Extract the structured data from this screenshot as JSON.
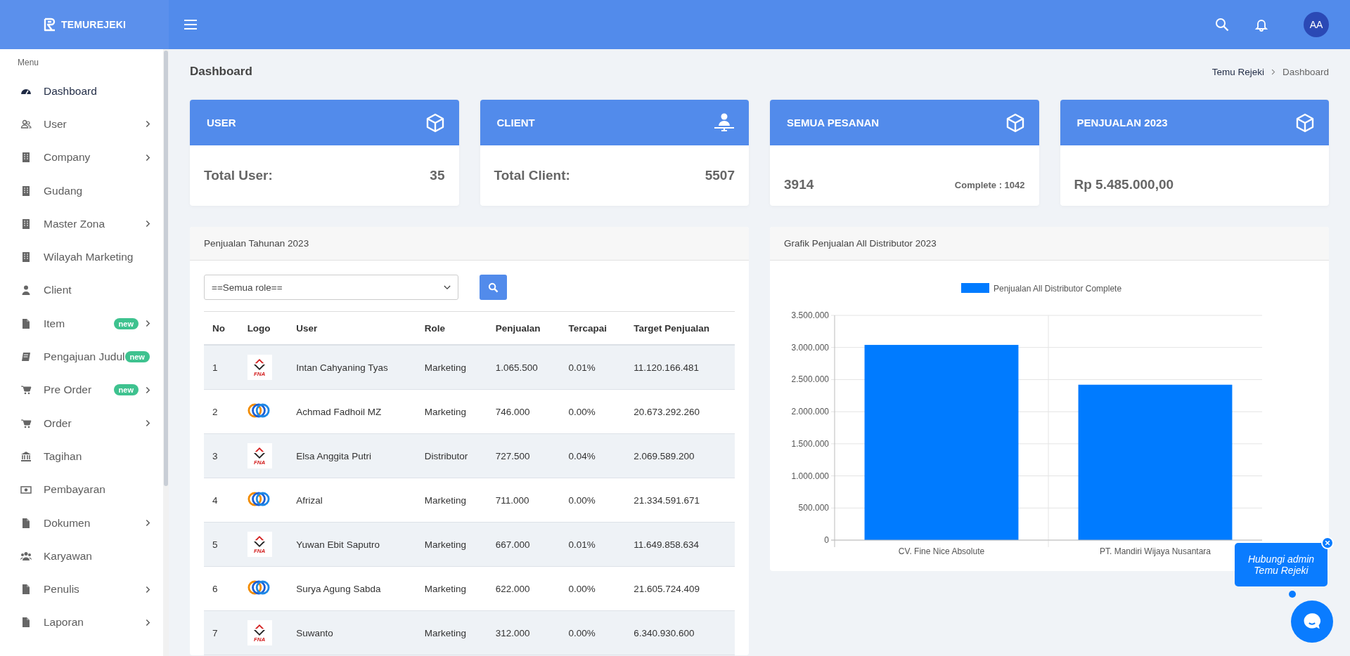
{
  "brand": {
    "name": "TEMUREJEKI"
  },
  "header": {
    "avatar": "AA"
  },
  "sidebar": {
    "heading": "Menu",
    "items": [
      {
        "label": "Dashboard",
        "kind": "gauge",
        "selected": true,
        "expandable": false
      },
      {
        "label": "User",
        "kind": "users",
        "selected": false,
        "expandable": true
      },
      {
        "label": "Company",
        "kind": "building",
        "selected": false,
        "expandable": true
      },
      {
        "label": "Gudang",
        "kind": "building",
        "selected": false,
        "expandable": false
      },
      {
        "label": "Master Zona",
        "kind": "building",
        "selected": false,
        "expandable": true
      },
      {
        "label": "Wilayah Marketing",
        "kind": "building",
        "selected": false,
        "expandable": false
      },
      {
        "label": "Client",
        "kind": "user",
        "selected": false,
        "expandable": false
      },
      {
        "label": "Item",
        "kind": "file",
        "selected": false,
        "expandable": true,
        "badge": "new"
      },
      {
        "label": "Pengajuan Judul",
        "kind": "book",
        "selected": false,
        "expandable": false,
        "badge": "new"
      },
      {
        "label": "Pre Order",
        "kind": "cart",
        "selected": false,
        "expandable": true,
        "badge": "new"
      },
      {
        "label": "Order",
        "kind": "cart",
        "selected": false,
        "expandable": true
      },
      {
        "label": "Tagihan",
        "kind": "bank",
        "selected": false,
        "expandable": false
      },
      {
        "label": "Pembayaran",
        "kind": "money",
        "selected": false,
        "expandable": false
      },
      {
        "label": "Dokumen",
        "kind": "file",
        "selected": false,
        "expandable": true
      },
      {
        "label": "Karyawan",
        "kind": "group",
        "selected": false,
        "expandable": false
      },
      {
        "label": "Penulis",
        "kind": "file",
        "selected": false,
        "expandable": true
      },
      {
        "label": "Laporan",
        "kind": "file",
        "selected": false,
        "expandable": true
      }
    ]
  },
  "page": {
    "title": "Dashboard",
    "breadcrumb": [
      "Temu Rejeki",
      "Dashboard"
    ]
  },
  "stats": [
    {
      "title": "USER",
      "kind": "cube",
      "label": "Total User:",
      "value": "35"
    },
    {
      "title": "CLIENT",
      "kind": "person",
      "label": "Total Client:",
      "value": "5507"
    },
    {
      "title": "SEMUA PESANAN",
      "kind": "cube",
      "value": "3914",
      "note": "Complete : 1042"
    },
    {
      "title": "PENJUALAN 2023",
      "kind": "cube",
      "value": "Rp 5.485.000,00"
    }
  ],
  "sales_table": {
    "title": "Penjualan Tahunan 2023",
    "role_select": "==Semua role==",
    "columns": [
      "No",
      "Logo",
      "User",
      "Role",
      "Penjualan",
      "Tercapai",
      "Target Penjualan"
    ],
    "rows": [
      {
        "no": "1",
        "kind": "fna",
        "logo_text": "FNA",
        "user": "Intan Cahyaning Tyas",
        "role": "Marketing",
        "sales": "1.065.500",
        "achieved": "0.01%",
        "target": "11.120.166.481"
      },
      {
        "no": "2",
        "kind": "rings",
        "user": "Achmad Fadhoil MZ",
        "role": "Marketing",
        "sales": "746.000",
        "achieved": "0.00%",
        "target": "20.673.292.260"
      },
      {
        "no": "3",
        "kind": "fna",
        "logo_text": "FNA",
        "user": "Elsa Anggita Putri",
        "role": "Distributor",
        "sales": "727.500",
        "achieved": "0.04%",
        "target": "2.069.589.200"
      },
      {
        "no": "4",
        "kind": "rings",
        "user": "Afrizal",
        "role": "Marketing",
        "sales": "711.000",
        "achieved": "0.00%",
        "target": "21.334.591.671"
      },
      {
        "no": "5",
        "kind": "fna",
        "logo_text": "FNA",
        "user": "Yuwan Ebit Saputro",
        "role": "Marketing",
        "sales": "667.000",
        "achieved": "0.01%",
        "target": "11.649.858.634"
      },
      {
        "no": "6",
        "kind": "rings",
        "user": "Surya Agung Sabda",
        "role": "Marketing",
        "sales": "622.000",
        "achieved": "0.00%",
        "target": "21.605.724.409"
      },
      {
        "no": "7",
        "kind": "fna",
        "logo_text": "FNA",
        "user": "Suwanto",
        "role": "Marketing",
        "sales": "312.000",
        "achieved": "0.00%",
        "target": "6.340.930.600"
      }
    ]
  },
  "chart_panel": {
    "title": "Grafik Penjualan All Distributor 2023",
    "chart_data": {
      "type": "bar",
      "categories": [
        "CV. Fine Nice Absolute",
        "PT. Mandiri Wijaya Nusantara"
      ],
      "series": [
        {
          "name": "Penjualan All Distributor Complete",
          "color": "#007bff",
          "values": [
            3040000,
            2420000
          ]
        }
      ],
      "grid": true,
      "ylim": [
        0,
        3500000
      ],
      "yticks": [
        {
          "value": 0,
          "label": "0"
        },
        {
          "value": 500000,
          "label": "500.000"
        },
        {
          "value": 1000000,
          "label": "1.000.000"
        },
        {
          "value": 1500000,
          "label": "1.500.000"
        },
        {
          "value": 2000000,
          "label": "2.000.000"
        },
        {
          "value": 2500000,
          "label": "2.500.000"
        },
        {
          "value": 3000000,
          "label": "3.000.000"
        },
        {
          "value": 3500000,
          "label": "3.500.000"
        }
      ]
    }
  },
  "chat": {
    "bubble": "Hubungi admin Temu Rejeki"
  }
}
